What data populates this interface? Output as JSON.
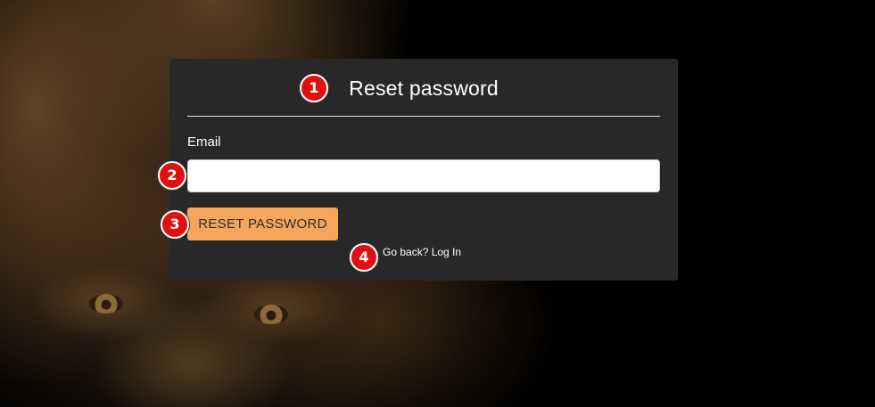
{
  "form": {
    "title": "Reset password",
    "email_label": "Email",
    "email_value": "",
    "email_placeholder": "",
    "reset_button_label": "RESET PASSWORD",
    "back_link_label": "Go back? Log In"
  },
  "annotations": {
    "badge_1": "1",
    "badge_2": "2",
    "badge_3": "3",
    "badge_4": "4"
  },
  "colors": {
    "card_background": "#282828",
    "button_background": "#f5a65b",
    "badge_red": "#e01010"
  }
}
